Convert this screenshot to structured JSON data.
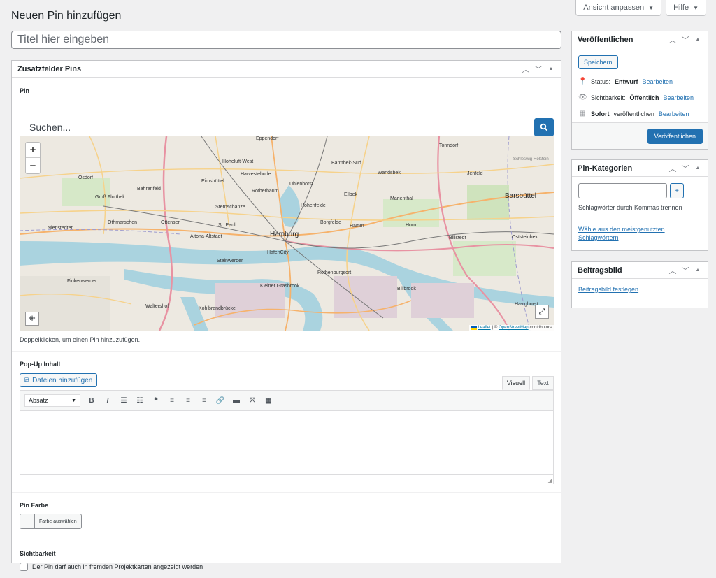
{
  "screen_meta": {
    "screen_options": "Ansicht anpassen",
    "help": "Hilfe"
  },
  "page": {
    "title": "Neuen Pin hinzufügen",
    "title_placeholder": "Titel hier eingeben"
  },
  "main_box": {
    "title": "Zusatzfelder Pins",
    "pin_label": "Pin",
    "search_placeholder": "Suchen...",
    "map_hint": "Doppelklicken, um einen Pin hinzuzufügen.",
    "map": {
      "labels": [
        "Eppendorf",
        "Tonndorf",
        "Hoheluft-West",
        "Barmbek-Süd",
        "Osdorf",
        "Eimsbüttel",
        "Harvestehude",
        "Uhlenhorst",
        "Wandsbek",
        "Jenfeld",
        "Bahrenfeld",
        "Rotherbaum",
        "Groß Flottbek",
        "Sternschanze",
        "Eilbek",
        "Marienthal",
        "Barsbüttel",
        "Hohenfelde",
        "Othmarschen",
        "Ottensen",
        "St. Pauli",
        "Borgfelde",
        "Hamm",
        "Horn",
        "Nienstedten",
        "Altona-Altstadt",
        "Hamburg",
        "Billstedt",
        "Oststeinbek",
        "HafenCity",
        "Steinwerder",
        "Rothenburgsort",
        "Finkenwerder",
        "Kleiner Grasbrook",
        "Billbrook",
        "Waltershof",
        "Kohlbrandbrücke",
        "Havighorst",
        "Schleswig-Holstein"
      ],
      "attribution": {
        "leaflet": "Leaflet",
        "osm": "OpenStreetMap",
        "suffix": "contributors"
      },
      "zoom_in": "+",
      "zoom_out": "−"
    },
    "popup_label": "Pop-Up Inhalt",
    "add_media": "Dateien hinzufügen",
    "tab_visual": "Visuell",
    "tab_text": "Text",
    "format_select": "Absatz",
    "color_label": "Pin Farbe",
    "color_button": "Farbe auswählen",
    "visibility_label": "Sichtbarkeit",
    "visibility_checkbox": "Der Pin darf auch in fremden Projektkarten angezeigt werden"
  },
  "publish_box": {
    "title": "Veröffentlichen",
    "save": "Speichern",
    "status_label": "Status:",
    "status_value": "Entwurf",
    "visibility_label": "Sichtbarkeit:",
    "visibility_value": "Öffentlich",
    "schedule_value": "Sofort",
    "schedule_label": "veröffentlichen",
    "edit": "Bearbeiten",
    "publish": "Veröffentlichen"
  },
  "category_box": {
    "title": "Pin-Kategorien",
    "add": "+",
    "hint": "Schlagwörter durch Kommas trennen",
    "most_used": "Wähle aus den meistgenutzten Schlagwörtern"
  },
  "image_box": {
    "title": "Beitragsbild",
    "set": "Beitragsbild festlegen"
  }
}
